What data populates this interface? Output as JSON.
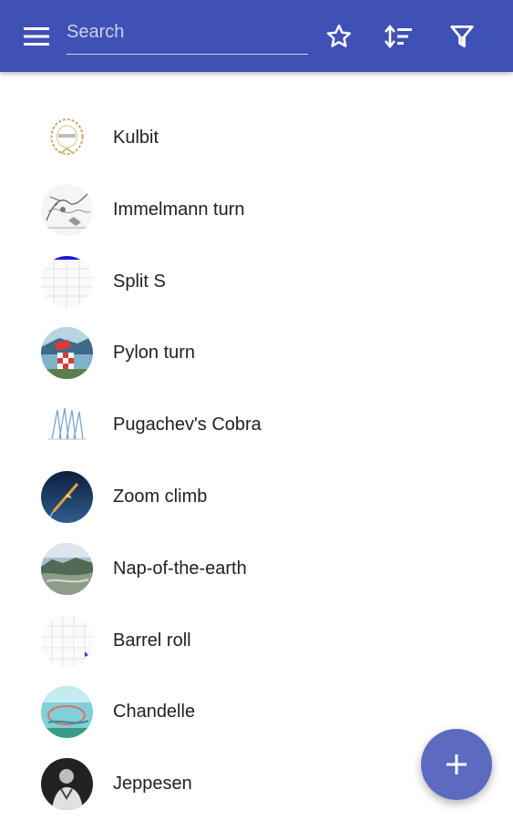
{
  "toolbar": {
    "menu_icon": "menu-icon",
    "search_placeholder": "Search",
    "search_value": "",
    "actions": [
      "star-icon",
      "sort-icon",
      "filter-icon"
    ],
    "color": "#3f51b5"
  },
  "items": [
    {
      "label": "Kulbit"
    },
    {
      "label": "Immelmann turn"
    },
    {
      "label": "Split S"
    },
    {
      "label": "Pylon turn"
    },
    {
      "label": "Pugachev's Cobra"
    },
    {
      "label": "Zoom climb"
    },
    {
      "label": "Nap-of-the-earth"
    },
    {
      "label": "Barrel roll"
    },
    {
      "label": "Chandelle"
    },
    {
      "label": "Jeppesen"
    }
  ],
  "fab": {
    "icon": "plus-icon",
    "color": "#5c6bc0"
  }
}
